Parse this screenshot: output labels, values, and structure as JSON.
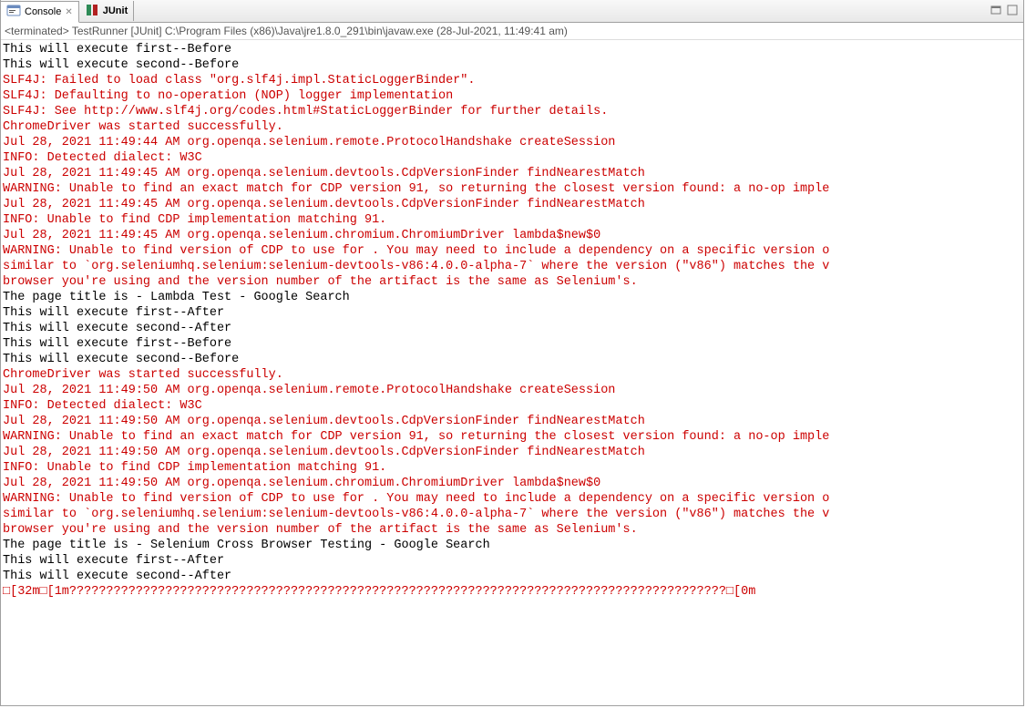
{
  "tabs": {
    "console": {
      "label": "Console"
    },
    "junit": {
      "label": "JUnit"
    }
  },
  "subheader": "<terminated> TestRunner [JUnit] C:\\Program Files (x86)\\Java\\jre1.8.0_291\\bin\\javaw.exe (28-Jul-2021, 11:49:41 am)",
  "lines": [
    {
      "cls": "line-out",
      "text": "This will execute first--Before"
    },
    {
      "cls": "line-out",
      "text": "This will execute second--Before"
    },
    {
      "cls": "line-err",
      "text": "SLF4J: Failed to load class \"org.slf4j.impl.StaticLoggerBinder\"."
    },
    {
      "cls": "line-err",
      "text": "SLF4J: Defaulting to no-operation (NOP) logger implementation"
    },
    {
      "cls": "line-err",
      "text": "SLF4J: See http://www.slf4j.org/codes.html#StaticLoggerBinder for further details."
    },
    {
      "cls": "line-err",
      "text": "ChromeDriver was started successfully."
    },
    {
      "cls": "line-err",
      "text": "Jul 28, 2021 11:49:44 AM org.openqa.selenium.remote.ProtocolHandshake createSession"
    },
    {
      "cls": "line-err",
      "text": "INFO: Detected dialect: W3C"
    },
    {
      "cls": "line-err",
      "text": "Jul 28, 2021 11:49:45 AM org.openqa.selenium.devtools.CdpVersionFinder findNearestMatch"
    },
    {
      "cls": "line-err",
      "text": "WARNING: Unable to find an exact match for CDP version 91, so returning the closest version found: a no-op imple"
    },
    {
      "cls": "line-err",
      "text": "Jul 28, 2021 11:49:45 AM org.openqa.selenium.devtools.CdpVersionFinder findNearestMatch"
    },
    {
      "cls": "line-err",
      "text": "INFO: Unable to find CDP implementation matching 91."
    },
    {
      "cls": "line-err",
      "text": "Jul 28, 2021 11:49:45 AM org.openqa.selenium.chromium.ChromiumDriver lambda$new$0"
    },
    {
      "cls": "line-err",
      "text": "WARNING: Unable to find version of CDP to use for . You may need to include a dependency on a specific version o"
    },
    {
      "cls": "line-err",
      "text": "similar to `org.seleniumhq.selenium:selenium-devtools-v86:4.0.0-alpha-7` where the version (\"v86\") matches the v"
    },
    {
      "cls": "line-err",
      "text": "browser you're using and the version number of the artifact is the same as Selenium's."
    },
    {
      "cls": "line-out",
      "text": "The page title is - Lambda Test - Google Search"
    },
    {
      "cls": "line-out",
      "text": "This will execute first--After"
    },
    {
      "cls": "line-out",
      "text": "This will execute second--After"
    },
    {
      "cls": "line-out",
      "text": "This will execute first--Before"
    },
    {
      "cls": "line-out",
      "text": "This will execute second--Before"
    },
    {
      "cls": "line-err",
      "text": "ChromeDriver was started successfully."
    },
    {
      "cls": "line-err",
      "text": "Jul 28, 2021 11:49:50 AM org.openqa.selenium.remote.ProtocolHandshake createSession"
    },
    {
      "cls": "line-err",
      "text": "INFO: Detected dialect: W3C"
    },
    {
      "cls": "line-err",
      "text": "Jul 28, 2021 11:49:50 AM org.openqa.selenium.devtools.CdpVersionFinder findNearestMatch"
    },
    {
      "cls": "line-err",
      "text": "WARNING: Unable to find an exact match for CDP version 91, so returning the closest version found: a no-op imple"
    },
    {
      "cls": "line-err",
      "text": "Jul 28, 2021 11:49:50 AM org.openqa.selenium.devtools.CdpVersionFinder findNearestMatch"
    },
    {
      "cls": "line-err",
      "text": "INFO: Unable to find CDP implementation matching 91."
    },
    {
      "cls": "line-err",
      "text": "Jul 28, 2021 11:49:50 AM org.openqa.selenium.chromium.ChromiumDriver lambda$new$0"
    },
    {
      "cls": "line-err",
      "text": "WARNING: Unable to find version of CDP to use for . You may need to include a dependency on a specific version o"
    },
    {
      "cls": "line-err",
      "text": "similar to `org.seleniumhq.selenium:selenium-devtools-v86:4.0.0-alpha-7` where the version (\"v86\") matches the v"
    },
    {
      "cls": "line-err",
      "text": "browser you're using and the version number of the artifact is the same as Selenium's."
    },
    {
      "cls": "line-out",
      "text": "The page title is - Selenium Cross Browser Testing - Google Search"
    },
    {
      "cls": "line-out",
      "text": "This will execute first--After"
    },
    {
      "cls": "line-out",
      "text": "This will execute second--After"
    },
    {
      "cls": "line-err",
      "text": "□[32m□[1m?????????????????????????????????????????????????????????????????????????????????????????□[0m"
    }
  ]
}
